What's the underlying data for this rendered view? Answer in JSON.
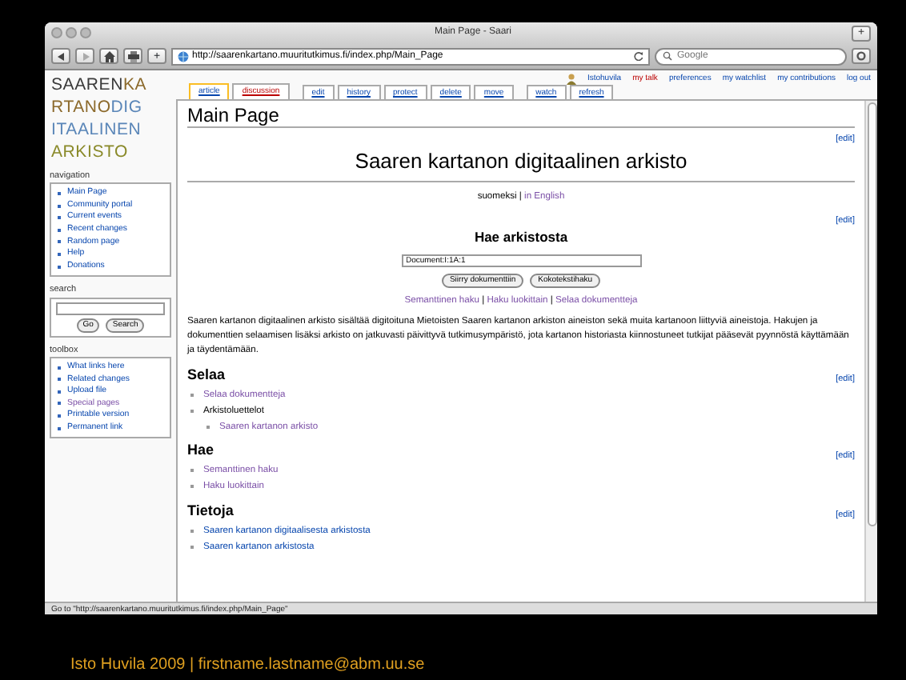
{
  "window": {
    "title": "Main Page - Saari",
    "new_tab": "+"
  },
  "toolbar": {
    "add": "+",
    "url": "http://saarenkartano.muuritutkimus.fi/index.php/Main_Page",
    "search_placeholder": "Google"
  },
  "user_links": [
    {
      "label": "Istohuvila",
      "missing": false
    },
    {
      "label": "my talk",
      "missing": true
    },
    {
      "label": "preferences",
      "missing": false
    },
    {
      "label": "my watchlist",
      "missing": false
    },
    {
      "label": "my contributions",
      "missing": false
    },
    {
      "label": "log out",
      "missing": false
    }
  ],
  "logo": [
    [
      {
        "text": "SAAREN",
        "color": "#3a3a3a"
      },
      {
        "text": "KA",
        "color": "#8c6a2c"
      }
    ],
    [
      {
        "text": "RTANO",
        "color": "#8c6a2c"
      },
      {
        "text": "DIG",
        "color": "#5a86b8"
      }
    ],
    [
      {
        "text": "ITAALINEN",
        "color": "#5a86b8"
      }
    ],
    [
      {
        "text": "ARKISTO",
        "color": "#8a8a2a"
      }
    ]
  ],
  "tab_groups": [
    [
      {
        "label": "article",
        "selected": true,
        "missing": false
      },
      {
        "label": "discussion",
        "selected": false,
        "missing": true
      }
    ],
    [
      {
        "label": "edit",
        "selected": false,
        "missing": false
      },
      {
        "label": "history",
        "selected": false,
        "missing": false
      },
      {
        "label": "protect",
        "selected": false,
        "missing": false
      },
      {
        "label": "delete",
        "selected": false,
        "missing": false
      },
      {
        "label": "move",
        "selected": false,
        "missing": false
      }
    ],
    [
      {
        "label": "watch",
        "selected": false,
        "missing": false
      },
      {
        "label": "refresh",
        "selected": false,
        "missing": false
      }
    ]
  ],
  "sidebar": {
    "navigation": {
      "title": "navigation",
      "items": [
        {
          "label": "Main Page",
          "visited": false
        },
        {
          "label": "Community portal",
          "visited": false
        },
        {
          "label": "Current events",
          "visited": false
        },
        {
          "label": "Recent changes",
          "visited": false
        },
        {
          "label": "Random page",
          "visited": false
        },
        {
          "label": "Help",
          "visited": false
        },
        {
          "label": "Donations",
          "visited": false
        }
      ]
    },
    "search": {
      "title": "search",
      "buttons": [
        "Go",
        "Search"
      ]
    },
    "toolbox": {
      "title": "toolbox",
      "items": [
        {
          "label": "What links here",
          "visited": false
        },
        {
          "label": "Related changes",
          "visited": false
        },
        {
          "label": "Upload file",
          "visited": false
        },
        {
          "label": "Special pages",
          "visited": true
        },
        {
          "label": "Printable version",
          "visited": false
        },
        {
          "label": "Permanent link",
          "visited": false
        }
      ]
    }
  },
  "page": {
    "title": "Main Page",
    "banner": {
      "edit_label": "[edit]",
      "heading": "Saaren kartanon digitaalinen arkisto",
      "languages": [
        {
          "label": "suomeksi",
          "link": false
        },
        {
          "label": "in English",
          "link": true
        }
      ],
      "separator": "|"
    },
    "search_section": {
      "edit_label": "[edit]",
      "heading": "Hae arkistosta",
      "value": "Document:I:1A:1",
      "buttons": [
        "Siirry dokumenttiin",
        "Kokotekstihaku"
      ],
      "links": [
        {
          "label": "Semanttinen haku",
          "visited": true
        },
        {
          "label": "Haku luokittain",
          "visited": true
        },
        {
          "label": "Selaa dokumentteja",
          "visited": true
        }
      ],
      "separators": [
        "|",
        "|"
      ]
    },
    "intro": "Saaren kartanon digitaalinen arkisto sisältää digitoituna Mietoisten Saaren kartanon arkiston aineiston sekä muita kartanoon liittyviä aineistoja. Hakujen ja dokumenttien selaamisen lisäksi arkisto on jatkuvasti päivittyvä tutkimusympäristö, jota kartanon historiasta kiinnostuneet tutkijat pääsevät pyynnöstä käyttämään ja täydentämään.",
    "sections": [
      {
        "edit_label": "[edit]",
        "heading": "Selaa",
        "items": [
          {
            "kind": "link",
            "label": "Selaa dokumentteja",
            "visited": true
          },
          {
            "kind": "text",
            "label": "Arkistoluettelot",
            "children": [
              {
                "kind": "link",
                "label": "Saaren kartanon arkisto",
                "visited": true
              }
            ]
          }
        ]
      },
      {
        "edit_label": "[edit]",
        "heading": "Hae",
        "items": [
          {
            "kind": "link",
            "label": "Semanttinen haku",
            "visited": true
          },
          {
            "kind": "link",
            "label": "Haku luokittain",
            "visited": true
          }
        ]
      },
      {
        "edit_label": "[edit]",
        "heading": "Tietoja",
        "items": [
          {
            "kind": "link",
            "label": "Saaren kartanon digitaalisesta arkistosta",
            "visited": false
          },
          {
            "kind": "link",
            "label": "Saaren kartanon arkistosta",
            "visited": false
          }
        ]
      }
    ]
  },
  "status_bar": "Go to \"http://saarenkartano.muuritutkimus.fi/index.php/Main_Page\"",
  "footer": "Isto Huvila 2009 | firstname.lastname@abm.uu.se"
}
